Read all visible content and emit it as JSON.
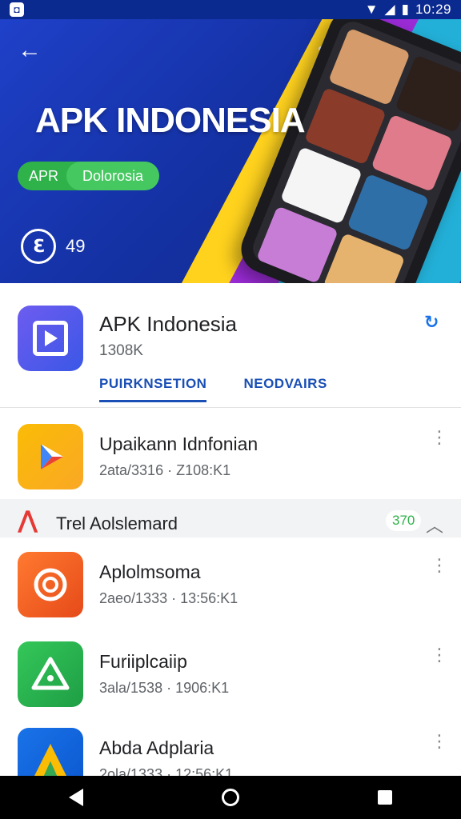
{
  "status_bar": {
    "left_icon": "notification-icon",
    "time": "10:29",
    "icons": [
      "wifi-icon",
      "signal-icon",
      "battery-icon"
    ]
  },
  "hero": {
    "back_icon": "back-arrow-icon",
    "title": "APK INDONESIA",
    "pill_left": "APR",
    "pill_right": "Dolorosia",
    "badge_icon": "e-circle-icon",
    "badge_count": "49"
  },
  "app": {
    "name": "APK Indonesia",
    "sub": "1308K",
    "refresh_icon": "refresh-icon",
    "tabs": [
      {
        "label": "PUIRKNSETION",
        "active": true
      },
      {
        "label": "NEODVAIRS",
        "active": false
      }
    ]
  },
  "items": [
    {
      "title": "Upaikann Idnfonian",
      "meta": "2ata/3316 · Z108:K1",
      "icon": "play-store-icon",
      "color": "#fbbc05"
    },
    {
      "title": "Aplolmsoma",
      "meta": "2aeo/1333 · 13:56:K1",
      "icon": "target-icon",
      "color": "#f4511e"
    },
    {
      "title": "Furiiplcaiip",
      "meta": "3ala/1538 · 1906:K1",
      "icon": "triangle-icon",
      "color": "#2fb24a"
    },
    {
      "title": "Abda Adplaria",
      "meta": "2ola/1333 · 12:56:K1",
      "icon": "a-logo-icon",
      "color": "#1a73e8"
    }
  ],
  "section": {
    "icon": "a-red-icon",
    "title": "Trel Aolslemard",
    "count": "370",
    "chevron": "chevron-up-icon"
  },
  "nav": {
    "back": "nav-back-icon",
    "home": "nav-home-icon",
    "recent": "nav-recent-icon"
  }
}
